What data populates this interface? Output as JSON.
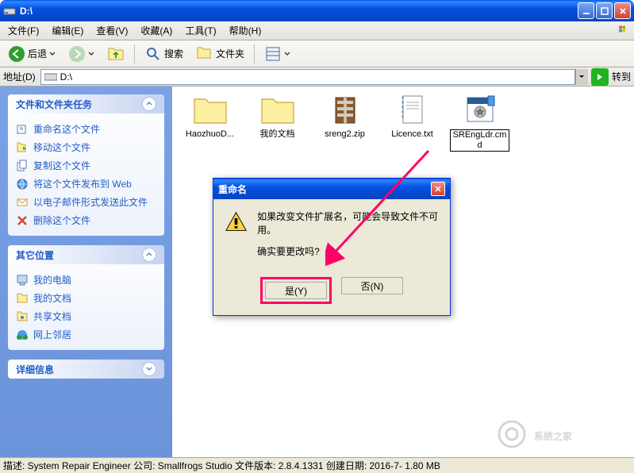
{
  "window": {
    "title": "D:\\"
  },
  "menu": {
    "file": "文件(F)",
    "edit": "编辑(E)",
    "view": "查看(V)",
    "favorites": "收藏(A)",
    "tools": "工具(T)",
    "help": "帮助(H)"
  },
  "toolbar": {
    "back": "后退",
    "search": "搜索",
    "folders": "文件夹"
  },
  "address": {
    "label": "地址(D)",
    "path": "D:\\",
    "go": "转到"
  },
  "sidebar": {
    "panel1": {
      "title": "文件和文件夹任务",
      "items": [
        {
          "icon": "rename",
          "label": "重命名这个文件"
        },
        {
          "icon": "move",
          "label": "移动这个文件"
        },
        {
          "icon": "copy",
          "label": "复制这个文件"
        },
        {
          "icon": "web",
          "label": "将这个文件发布到 Web"
        },
        {
          "icon": "mail",
          "label": "以电子邮件形式发送此文件"
        },
        {
          "icon": "delete",
          "label": "删除这个文件"
        }
      ]
    },
    "panel2": {
      "title": "其它位置",
      "items": [
        {
          "icon": "computer",
          "label": "我的电脑"
        },
        {
          "icon": "docs",
          "label": "我的文档"
        },
        {
          "icon": "shared",
          "label": "共享文档"
        },
        {
          "icon": "network",
          "label": "网上邻居"
        }
      ]
    },
    "panel3": {
      "title": "详细信息"
    }
  },
  "files": [
    {
      "name": "HaozhuoD...",
      "type": "folder"
    },
    {
      "name": "我的文档",
      "type": "folder"
    },
    {
      "name": "sreng2.zip",
      "type": "zip"
    },
    {
      "name": "Licence.txt",
      "type": "txt"
    },
    {
      "name": "SREngLdr.cmd",
      "type": "cmd",
      "selected": true
    }
  ],
  "dialog": {
    "title": "重命名",
    "line1": "如果改变文件扩展名，可能会导致文件不可用。",
    "line2": "确实要更改吗?",
    "yes": "是(Y)",
    "no": "否(N)"
  },
  "statusbar": "描述: System Repair Engineer 公司: Smallfrogs Studio 文件版本: 2.8.4.1331 创建日期: 2016-7-  1.80 MB",
  "watermark": "系统之家"
}
